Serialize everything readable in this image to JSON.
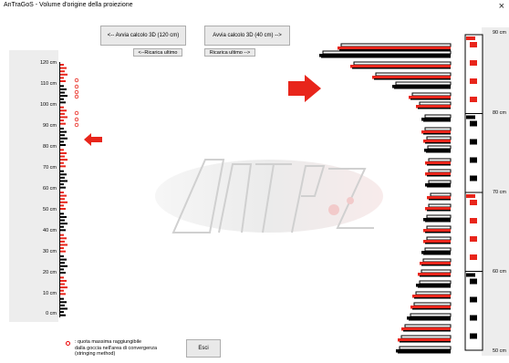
{
  "window": {
    "title": "AnTraGoS - Volume d'origine della proiezione",
    "close_symbol": "×"
  },
  "buttons": {
    "run_120": "<-- Avvia calcolo 3D (120 cm)",
    "run_40": "Avvia calcolo 3D (40 cm) -->",
    "reload_left": "<--Ricarica ultimo",
    "reload_right": "Ricarica ultimo -->",
    "exit": "Esci"
  },
  "left_scale": {
    "labels": [
      "120 cm",
      "110 cm",
      "100 cm",
      "90 cm",
      "80 cm",
      "70 cm",
      "60 cm",
      "50 cm",
      "40 cm",
      "30 cm",
      "20 cm",
      "10 cm",
      "0 cm"
    ]
  },
  "right_scale": {
    "labels": [
      "90 cm",
      "80 cm",
      "70 cm",
      "60 cm",
      "50 cm"
    ]
  },
  "legend": {
    "symbol": "o",
    "lines": [
      ": quota massima raggiungibile",
      "dalla goccia nell'area di convergenza",
      "(stringing method)"
    ]
  },
  "colors": {
    "accent_red": "#e8251b",
    "black": "#000000",
    "panel_gray": "#ededed"
  }
}
